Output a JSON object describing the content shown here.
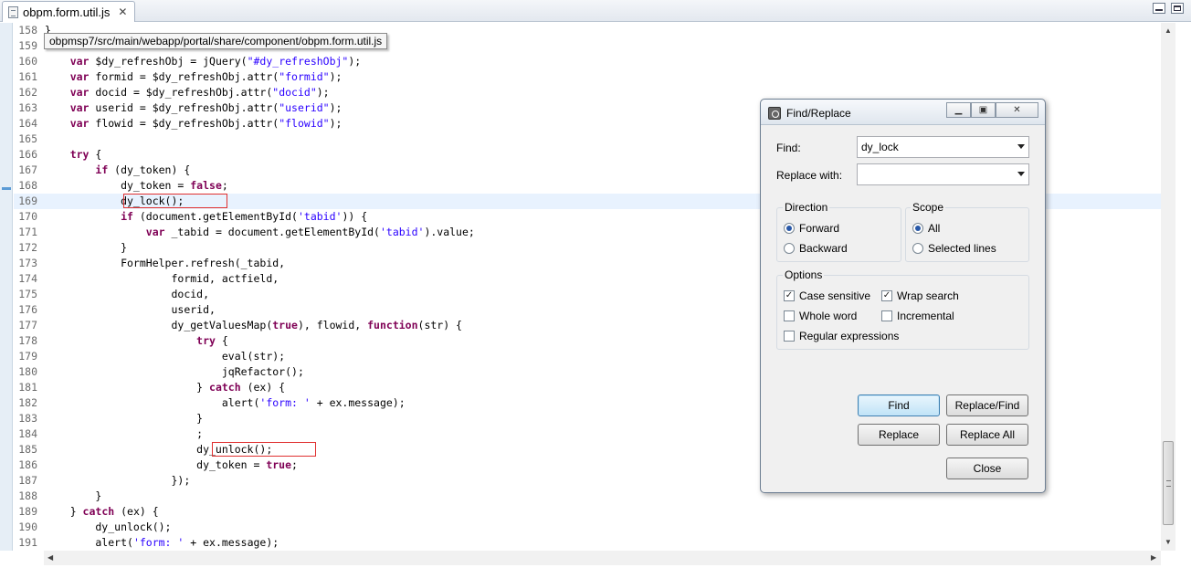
{
  "tab": {
    "title": "obpm.form.util.js",
    "close": "✕"
  },
  "tooltip": "obpmsp7/src/main/webapp/portal/share/component/obpm.form.util.js",
  "dialog": {
    "title": "Find/Replace",
    "find_label": "Find:",
    "find_value": "dy_lock",
    "replace_label": "Replace with:",
    "replace_value": "",
    "direction": {
      "title": "Direction",
      "forward": "Forward",
      "backward": "Backward",
      "selected": "Forward"
    },
    "scope": {
      "title": "Scope",
      "all": "All",
      "selected_lines": "Selected lines",
      "selected": "All"
    },
    "options": {
      "title": "Options",
      "case_sensitive": "Case sensitive",
      "wrap_search": "Wrap search",
      "whole_word": "Whole word",
      "incremental": "Incremental",
      "regex": "Regular expressions"
    },
    "buttons": {
      "find": "Find",
      "replace_find": "Replace/Find",
      "replace": "Replace",
      "replace_all": "Replace All",
      "close": "Close"
    }
  },
  "code_lines": [
    {
      "num": "158",
      "tokens": [
        [
          "",
          "}"
        ]
      ]
    },
    {
      "num": "159",
      "tokens": []
    },
    {
      "num": "160",
      "tokens": [
        [
          "",
          "    "
        ],
        [
          "kw",
          "var"
        ],
        [
          "",
          " $dy_refreshObj = jQuery("
        ],
        [
          "str",
          "\"#dy_refreshObj\""
        ],
        [
          "",
          ");"
        ]
      ]
    },
    {
      "num": "161",
      "tokens": [
        [
          "",
          "    "
        ],
        [
          "kw",
          "var"
        ],
        [
          "",
          " formid = $dy_refreshObj.attr("
        ],
        [
          "str",
          "\"formid\""
        ],
        [
          "",
          ");"
        ]
      ]
    },
    {
      "num": "162",
      "tokens": [
        [
          "",
          "    "
        ],
        [
          "kw",
          "var"
        ],
        [
          "",
          " docid = $dy_refreshObj.attr("
        ],
        [
          "str",
          "\"docid\""
        ],
        [
          "",
          ");"
        ]
      ]
    },
    {
      "num": "163",
      "tokens": [
        [
          "",
          "    "
        ],
        [
          "kw",
          "var"
        ],
        [
          "",
          " userid = $dy_refreshObj.attr("
        ],
        [
          "str",
          "\"userid\""
        ],
        [
          "",
          ");"
        ]
      ]
    },
    {
      "num": "164",
      "tokens": [
        [
          "",
          "    "
        ],
        [
          "kw",
          "var"
        ],
        [
          "",
          " flowid = $dy_refreshObj.attr("
        ],
        [
          "str",
          "\"flowid\""
        ],
        [
          "",
          ");"
        ]
      ]
    },
    {
      "num": "165",
      "tokens": []
    },
    {
      "num": "166",
      "tokens": [
        [
          "",
          "    "
        ],
        [
          "kw",
          "try"
        ],
        [
          "",
          " {"
        ]
      ]
    },
    {
      "num": "167",
      "tokens": [
        [
          "",
          "        "
        ],
        [
          "kw",
          "if"
        ],
        [
          "",
          " (dy_token) {"
        ]
      ]
    },
    {
      "num": "168",
      "tokens": [
        [
          "",
          "            dy_token = "
        ],
        [
          "kw",
          "false"
        ],
        [
          "",
          ";"
        ]
      ]
    },
    {
      "num": "169",
      "tokens": [
        [
          "",
          "            dy_lock();"
        ]
      ]
    },
    {
      "num": "170",
      "tokens": [
        [
          "",
          "            "
        ],
        [
          "kw",
          "if"
        ],
        [
          "",
          " (document.getElementById("
        ],
        [
          "str",
          "'tabid'"
        ],
        [
          "",
          ")) {"
        ]
      ]
    },
    {
      "num": "171",
      "tokens": [
        [
          "",
          "                "
        ],
        [
          "kw",
          "var"
        ],
        [
          "",
          " _tabid = document.getElementById("
        ],
        [
          "str",
          "'tabid'"
        ],
        [
          "",
          ").value;"
        ]
      ]
    },
    {
      "num": "172",
      "tokens": [
        [
          "",
          "            }"
        ]
      ]
    },
    {
      "num": "173",
      "tokens": [
        [
          "",
          "            FormHelper.refresh(_tabid,"
        ]
      ]
    },
    {
      "num": "174",
      "tokens": [
        [
          "",
          "                    formid, actfield,"
        ]
      ]
    },
    {
      "num": "175",
      "tokens": [
        [
          "",
          "                    docid,"
        ]
      ]
    },
    {
      "num": "176",
      "tokens": [
        [
          "",
          "                    userid,"
        ]
      ]
    },
    {
      "num": "177",
      "tokens": [
        [
          "",
          "                    dy_getValuesMap("
        ],
        [
          "kw",
          "true"
        ],
        [
          "",
          "), flowid, "
        ],
        [
          "kw",
          "function"
        ],
        [
          "",
          "(str) {"
        ]
      ]
    },
    {
      "num": "178",
      "tokens": [
        [
          "",
          "                        "
        ],
        [
          "kw",
          "try"
        ],
        [
          "",
          " {"
        ]
      ]
    },
    {
      "num": "179",
      "tokens": [
        [
          "",
          "                            eval(str);"
        ]
      ]
    },
    {
      "num": "180",
      "tokens": [
        [
          "",
          "                            jqRefactor();"
        ]
      ]
    },
    {
      "num": "181",
      "tokens": [
        [
          "",
          "                        } "
        ],
        [
          "kw",
          "catch"
        ],
        [
          "",
          " (ex) {"
        ]
      ]
    },
    {
      "num": "182",
      "tokens": [
        [
          "",
          "                            alert("
        ],
        [
          "str",
          "'form: '"
        ],
        [
          "",
          " + ex.message);"
        ]
      ]
    },
    {
      "num": "183",
      "tokens": [
        [
          "",
          "                        }"
        ]
      ]
    },
    {
      "num": "184",
      "tokens": [
        [
          "",
          "                        ;"
        ]
      ]
    },
    {
      "num": "185",
      "tokens": [
        [
          "",
          "                        dy_unlock();"
        ]
      ]
    },
    {
      "num": "186",
      "tokens": [
        [
          "",
          "                        dy_token = "
        ],
        [
          "kw",
          "true"
        ],
        [
          "",
          ";"
        ]
      ]
    },
    {
      "num": "187",
      "tokens": [
        [
          "",
          "                    });"
        ]
      ]
    },
    {
      "num": "188",
      "tokens": [
        [
          "",
          "        }"
        ]
      ]
    },
    {
      "num": "189",
      "tokens": [
        [
          "",
          "    } "
        ],
        [
          "kw",
          "catch"
        ],
        [
          "",
          " (ex) {"
        ]
      ]
    },
    {
      "num": "190",
      "tokens": [
        [
          "",
          "        dy_unlock();"
        ]
      ]
    },
    {
      "num": "191",
      "tokens": [
        [
          "",
          "        alert("
        ],
        [
          "str",
          "'form: '"
        ],
        [
          "",
          " + ex.message);"
        ]
      ]
    }
  ]
}
